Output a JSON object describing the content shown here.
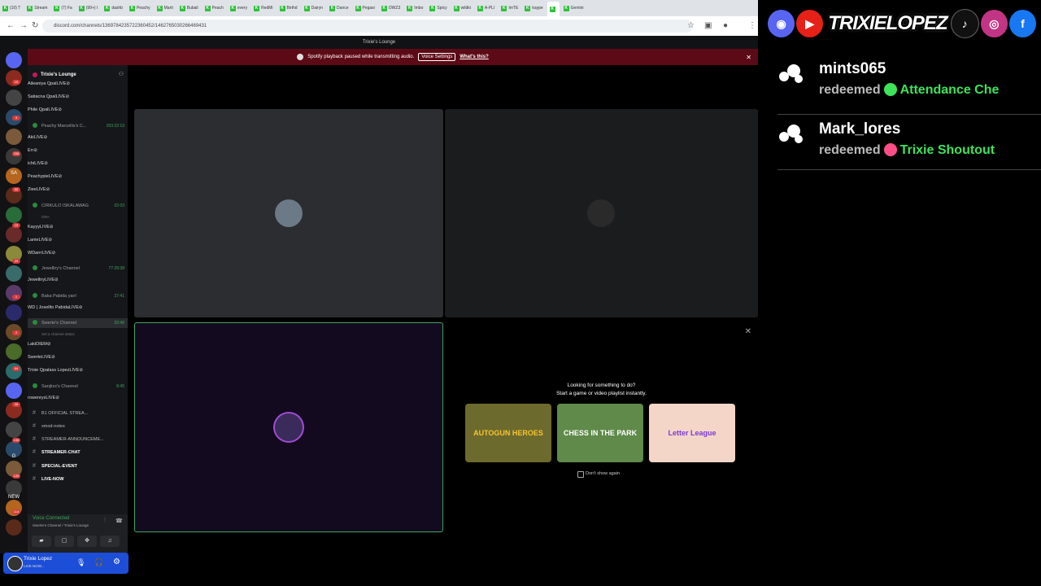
{
  "browser": {
    "tabs": [
      "(10) T",
      "Stream",
      "(7) Fa",
      "(99+) I",
      "dashb",
      "Peachy",
      "Marti",
      "Bubali",
      "Peach",
      "every",
      "RedMi",
      "Birthd",
      "Dairyn",
      "Dance",
      "Pegasi",
      "OWZ3",
      "Imbo",
      "Spicy",
      "wildki",
      "A-PLI",
      "ImTE",
      "kaype",
      "",
      "Gemini"
    ],
    "url": "discord.com/channels/1369784235722360452/1462765030266469431"
  },
  "discord": {
    "window_title": "Trixie's Lounge",
    "notice": {
      "text": "Spotify playback paused while transmitting audio.",
      "button": "Voice Settings",
      "link": "What's this?"
    },
    "server_name": "Trixie's Lounge",
    "guild_labels": {
      "sa": "SA",
      "g": "G",
      "new": "NEW"
    },
    "guild_badges": [
      "10",
      "3",
      "338",
      "60",
      "19",
      "29",
      "1",
      "2",
      "64",
      "26",
      "106",
      "120",
      "114"
    ],
    "rows": [
      {
        "kind": "user",
        "name": "Aileaniya Qpal",
        "live": "LIVE"
      },
      {
        "kind": "user",
        "name": "Satiacna Qpal",
        "live": "LIVE"
      },
      {
        "kind": "user",
        "name": "Phile Qpal",
        "live": "LIVE"
      },
      {
        "kind": "chan",
        "name": "Peachy Marcellis's C...",
        "time": "203:22:19"
      },
      {
        "kind": "user",
        "name": "Aki",
        "live": "LIVE"
      },
      {
        "kind": "user",
        "name": "Err",
        "live": ""
      },
      {
        "kind": "user",
        "name": "ichi",
        "live": "LIVE"
      },
      {
        "kind": "user",
        "name": "Peachypie",
        "live": "LIVE"
      },
      {
        "kind": "user",
        "name": "Ziee",
        "live": "LIVE"
      },
      {
        "kind": "chan",
        "name": "CIRKULO ISKALAWAG",
        "time": "03 03"
      },
      {
        "kind": "sub",
        "name": "GRA"
      },
      {
        "kind": "user",
        "name": "Kayyy",
        "live": "LIVE"
      },
      {
        "kind": "user",
        "name": "Lanie",
        "live": "LIVE"
      },
      {
        "kind": "user",
        "name": "WDarrr",
        "live": "LIVE"
      },
      {
        "kind": "chan",
        "name": "Jewelliry's Channel",
        "time": "77:29:38"
      },
      {
        "kind": "user",
        "name": "Jewelliry",
        "live": "LIVE"
      },
      {
        "kind": "chan",
        "name": "Baka Pabida yan!",
        "time": "37:41"
      },
      {
        "kind": "user",
        "name": "WD | Josellto Pabida",
        "live": "LIVE"
      },
      {
        "kind": "chan",
        "name": "Swerte's Channel",
        "time": "20:48"
      },
      {
        "kind": "sub",
        "name": "Set a channel status"
      },
      {
        "kind": "user",
        "name": "Laki",
        "live": "DIEM"
      },
      {
        "kind": "user",
        "name": "Swerte",
        "live": "LIVE"
      },
      {
        "kind": "user",
        "name": "Trixie Qpalass Lopez",
        "live": "LIVE"
      },
      {
        "kind": "chan",
        "name": "Sanjiixx's Channel",
        "time": "8:45"
      },
      {
        "kind": "user",
        "name": "rowenrys",
        "live": "LIVE"
      },
      {
        "kind": "txt",
        "name": "B1  OFFICIAL STREA..."
      },
      {
        "kind": "txt",
        "name": "smod-notes"
      },
      {
        "kind": "txt",
        "name": "STREAMER-ANNOUNCEME..."
      },
      {
        "kind": "txt",
        "name": "STREAMER-CHAT"
      },
      {
        "kind": "txt",
        "name": "SPECIAL-EVENT"
      },
      {
        "kind": "txt",
        "name": "LIVE-NOW"
      }
    ],
    "voice": {
      "status": "Voice Connected",
      "location": "Swerte's Channel / Trixie's Lounge"
    },
    "user": {
      "name": "Trixie Lopez",
      "status": "LIVE NOW..."
    },
    "activity": {
      "title": "Looking for something to do?",
      "subtitle": "Start a game or video playlist instantly.",
      "games": [
        "AUTOGUN HEROES",
        "CHESS IN THE PARK",
        "Letter League"
      ],
      "checkbox": "Don't show again"
    }
  },
  "overlay": {
    "brand": "TRIXIELOPEZ",
    "redemptions": [
      {
        "user": "mints065",
        "verb": "redeemed",
        "reward": "Attendance Che",
        "color": "#3ee35a"
      },
      {
        "user": "Mark_lores",
        "verb": "redeemed",
        "reward": "Trixie Shoutout",
        "color": "#ff4d88"
      }
    ]
  }
}
